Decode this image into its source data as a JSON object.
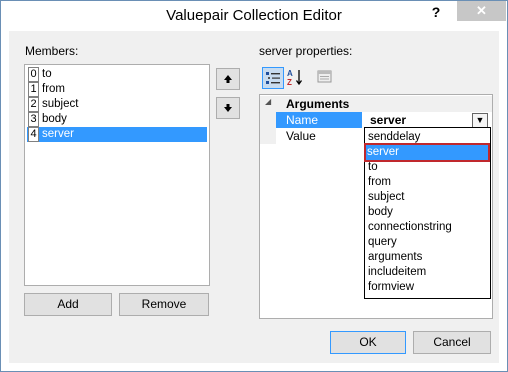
{
  "window": {
    "title": "Valuepair Collection Editor",
    "help_label": "?",
    "close_label": "✕"
  },
  "members": {
    "label": "Members:",
    "items": [
      {
        "index": "0",
        "name": "to"
      },
      {
        "index": "1",
        "name": "from"
      },
      {
        "index": "2",
        "name": "subject"
      },
      {
        "index": "3",
        "name": "body"
      },
      {
        "index": "4",
        "name": "server"
      }
    ],
    "selected_index": 4,
    "add_label": "Add",
    "remove_label": "Remove"
  },
  "properties": {
    "label": "server properties:",
    "category": "Arguments",
    "rows": [
      {
        "name": "Name",
        "value": "server"
      },
      {
        "name": "Value",
        "value": ""
      }
    ],
    "dropdown_options": [
      "senddelay",
      "server",
      "to",
      "from",
      "subject",
      "body",
      "connectionstring",
      "query",
      "arguments",
      "includeitem",
      "formview"
    ],
    "dropdown_selected": "server"
  },
  "footer": {
    "ok_label": "OK",
    "cancel_label": "Cancel"
  },
  "colors": {
    "selection": "#3399ff",
    "highlight_outline": "#c0282d"
  }
}
